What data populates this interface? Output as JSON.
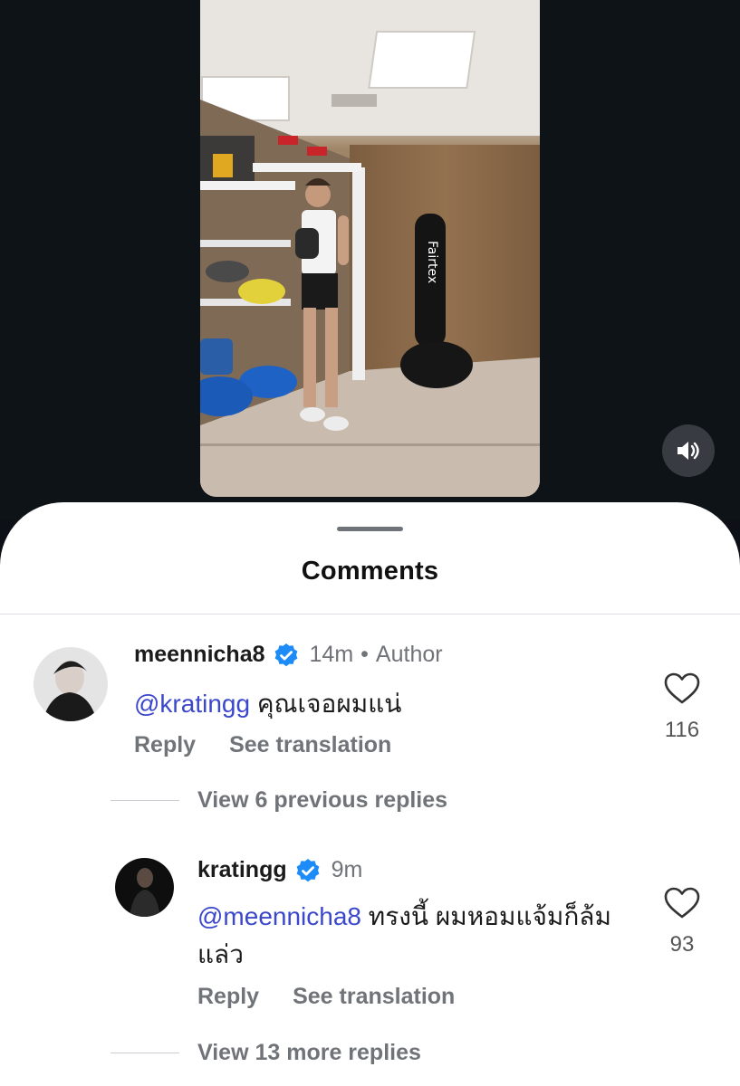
{
  "video": {
    "mute_icon": "speaker-icon",
    "punching_bag_text": "Fairtex"
  },
  "sheet": {
    "title": "Comments"
  },
  "comments": [
    {
      "username": "meennicha8",
      "verified": true,
      "time": "14m",
      "tag": "Author",
      "mention": "@kratingg",
      "text": " คุณเจอผมแน่",
      "reply_label": "Reply",
      "translate_label": "See translation",
      "likes": "116",
      "view_replies": "View 6 previous replies"
    },
    {
      "username": "kratingg",
      "verified": true,
      "time": "9m",
      "mention": "@meennicha8",
      "text": " ทรงนี้ ผมหอมแจ้มก็ล้มแล่ว",
      "reply_label": "Reply",
      "translate_label": "See translation",
      "likes": "93",
      "view_replies": "View 13 more replies"
    }
  ],
  "colors": {
    "mention": "#3c48cc",
    "verified": "#1d8cf8",
    "muted_text": "#707378"
  }
}
